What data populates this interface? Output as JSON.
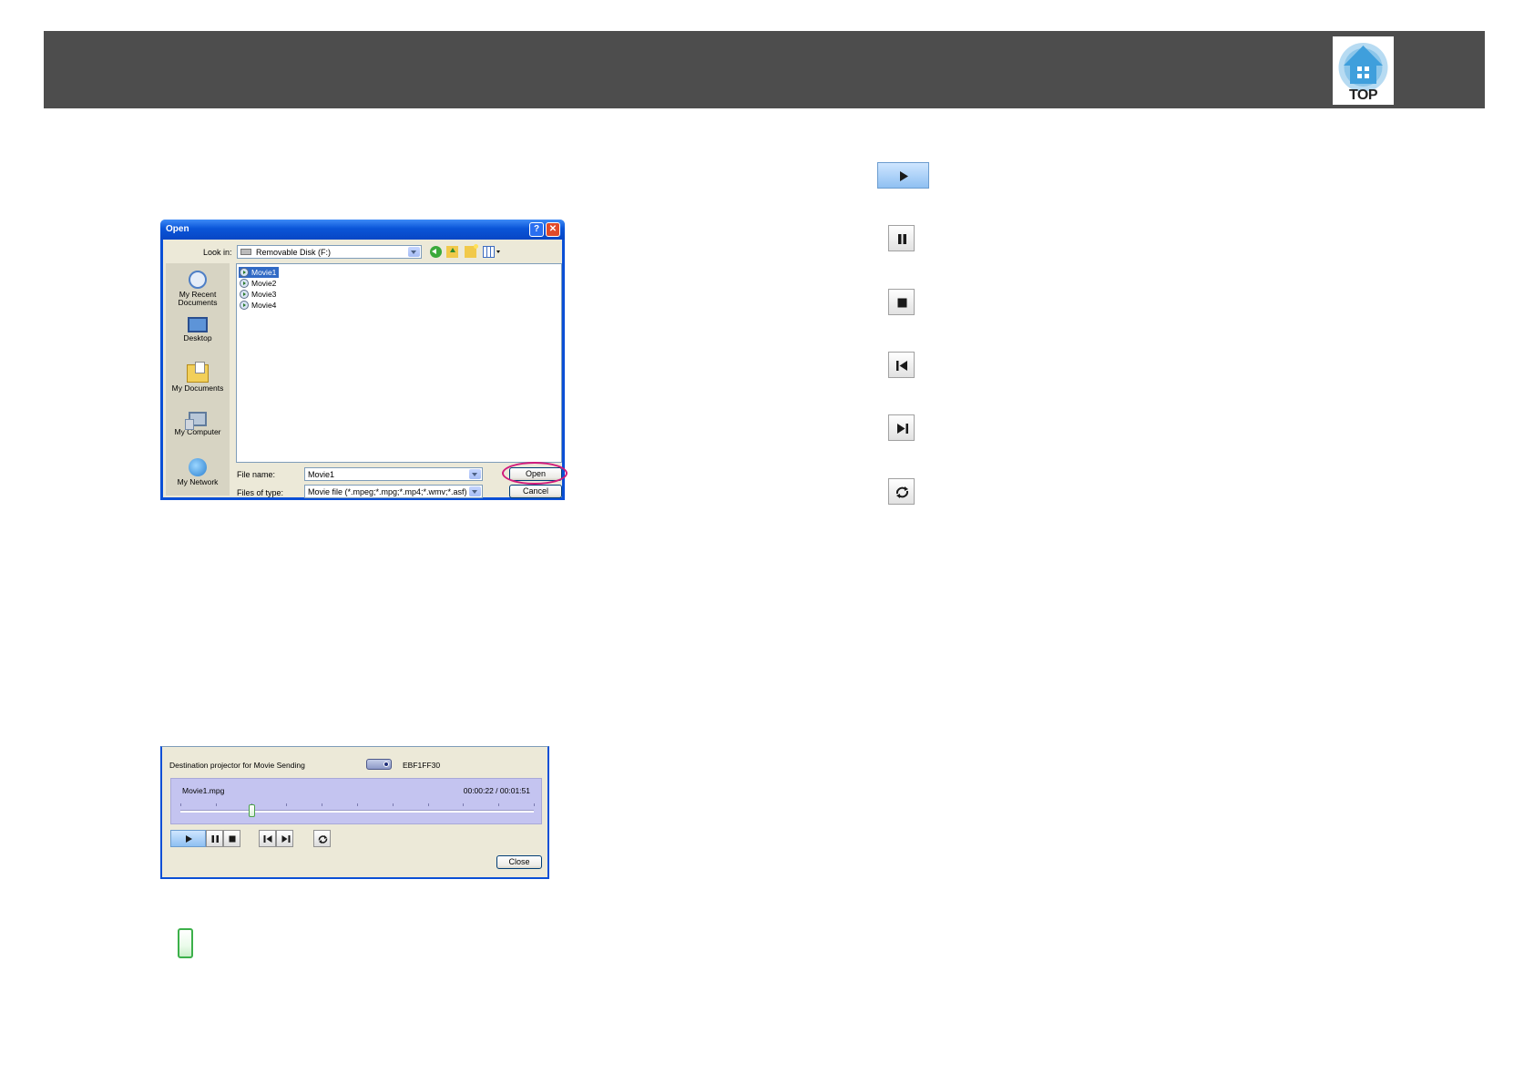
{
  "header": {
    "top_label": "TOP"
  },
  "open_dialog": {
    "title": "Open",
    "help_glyph": "?",
    "close_glyph": "✕",
    "look_in_label": "Look in:",
    "look_in_value": "Removable Disk (F:)",
    "places": [
      {
        "label": "My Recent Documents",
        "icon": "recent-documents-icon"
      },
      {
        "label": "Desktop",
        "icon": "desktop-icon"
      },
      {
        "label": "My Documents",
        "icon": "my-documents-icon"
      },
      {
        "label": "My Computer",
        "icon": "my-computer-icon"
      },
      {
        "label": "My Network",
        "icon": "my-network-icon"
      }
    ],
    "files": [
      "Movie1",
      "Movie2",
      "Movie3",
      "Movie4"
    ],
    "file_name_label": "File name:",
    "file_name_value": "Movie1",
    "files_of_type_label": "Files of type:",
    "files_of_type_value": "Movie file (*.mpeg;*.mpg;*.mp4;*.wmv;*.asf)",
    "open_button": "Open",
    "cancel_button": "Cancel",
    "highlight_color": "#d01a7c"
  },
  "control_icons": [
    "play-icon",
    "pause-icon",
    "stop-icon",
    "previous-icon",
    "next-icon",
    "repeat-icon"
  ],
  "movie_window": {
    "destination_label": "Destination projector for Movie Sending",
    "destination_value": "EBF1FF30",
    "file_name": "Movie1.mpg",
    "time": "00:00:22 / 00:01:51",
    "progress": 0.2,
    "close_button": "Close",
    "track_color": "#c4c4f0"
  },
  "seek_thumb": {
    "icon": "seek-slider-thumb-icon",
    "color": "#3cb04a"
  }
}
